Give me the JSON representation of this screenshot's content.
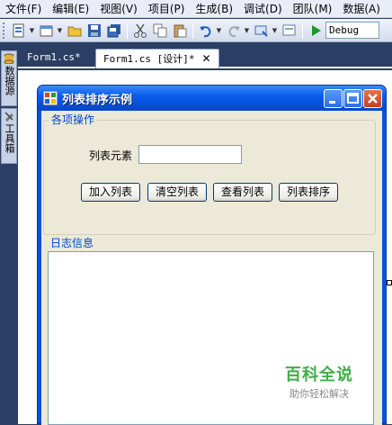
{
  "menu": {
    "items": [
      "文件(F)",
      "编辑(E)",
      "视图(V)",
      "项目(P)",
      "生成(B)",
      "调试(D)",
      "团队(M)",
      "数据(A)"
    ]
  },
  "toolbar": {
    "icons": [
      "new-project-icon",
      "add-item-icon",
      "open-icon",
      "save-icon",
      "save-all-icon",
      "cut-icon",
      "copy-icon",
      "paste-icon",
      "undo-icon",
      "redo-icon",
      "navigate-icon",
      "find-icon",
      "start-icon"
    ],
    "config_value": "Debug"
  },
  "dock": {
    "tabs": [
      "数据源",
      "工具箱"
    ]
  },
  "doc_tabs": [
    {
      "label": "Form1.cs*",
      "active": false
    },
    {
      "label": "Form1.cs [设计]*",
      "active": true
    }
  ],
  "form": {
    "title": "列表排序示例",
    "group_ops": {
      "title": "各项操作",
      "element_label": "列表元素",
      "element_value": "",
      "buttons": [
        "加入列表",
        "清空列表",
        "查看列表",
        "列表排序"
      ]
    },
    "group_log": {
      "title": "日志信息",
      "content": ""
    }
  },
  "watermark": {
    "main": "百科全说",
    "sub": "助你轻松解决"
  },
  "colors": {
    "ide_bg": "#2b3e63",
    "titlebar": "#0a5cf0",
    "groupbox_title": "#0046d5",
    "client_bg": "#ece9d8",
    "watermark": "#3fae49"
  }
}
